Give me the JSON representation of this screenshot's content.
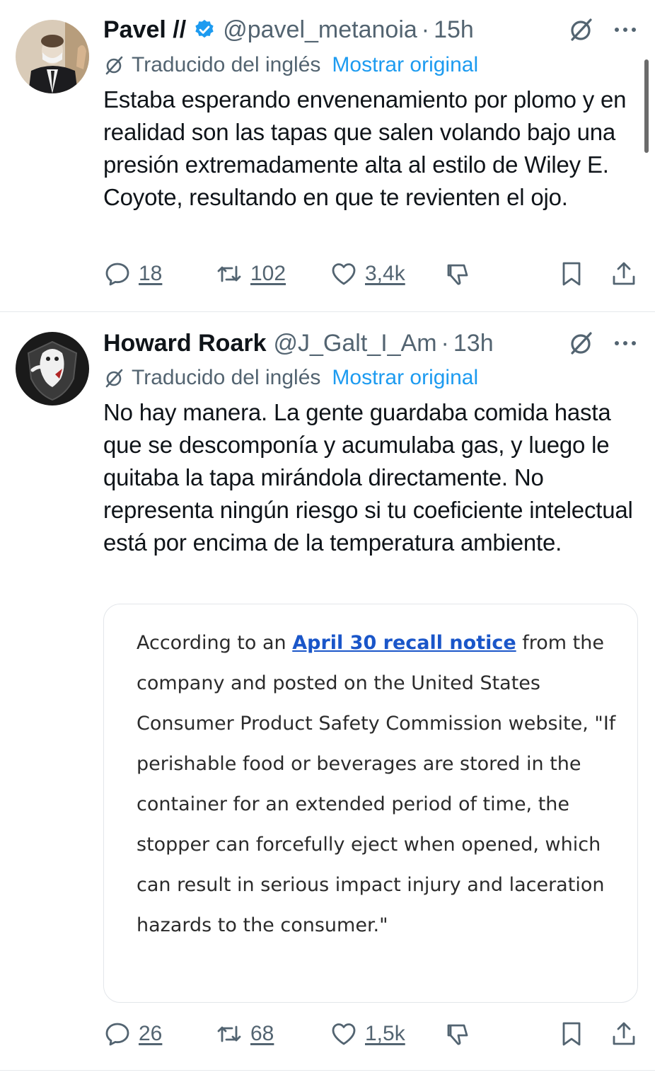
{
  "tweets": [
    {
      "display_name": "Pavel //",
      "verified": true,
      "handle": "@pavel_metanoia",
      "dot": "·",
      "time": "15h",
      "translated_label": "Traducido del inglés",
      "show_original": "Mostrar original",
      "text": "Estaba esperando envenenamiento por plomo y en realidad son las tapas que salen volando bajo una presión extremadamente alta al estilo de Wiley E. Coyote, resultando en que te revienten el ojo.",
      "stats": {
        "replies": "18",
        "reposts": "102",
        "likes": "3,4k"
      }
    },
    {
      "display_name": "Howard Roark",
      "verified": false,
      "handle": "@J_Galt_I_Am",
      "dot": "·",
      "time": "13h",
      "translated_label": "Traducido del inglés",
      "show_original": "Mostrar original",
      "text": "No hay manera. La gente guardaba comida hasta que se descomponía y acumulaba gas, y luego le quitaba la tapa mirándola directamente. No representa ningún riesgo si tu coeficiente intelectual está por encima de la temperatura ambiente.",
      "quote_image": {
        "before_link": "According to an ",
        "link_text": "April 30 recall notice",
        "after_link": " from the company and posted on the United States Consumer Product Safety Commission website, \"If perishable food or beverages are stored in the container for an extended period of time, the stopper can forcefully eject when opened, which can result in serious impact injury and laceration hazards to the consumer.\""
      },
      "stats": {
        "replies": "26",
        "reposts": "68",
        "likes": "1,5k"
      }
    }
  ],
  "colors": {
    "text": "#0f1419",
    "secondary": "#536471",
    "accent": "#1d9bf0",
    "link": "#1a56c9",
    "divider": "#e6e9ec"
  },
  "icons": {
    "verified": "verified-badge-icon",
    "grok": "grok-icon",
    "more": "more-icon",
    "translate": "translate-icon",
    "reply": "reply-icon",
    "repost": "repost-icon",
    "like": "heart-icon",
    "dislike": "dislike-icon",
    "bookmark": "bookmark-icon",
    "share": "share-icon"
  }
}
